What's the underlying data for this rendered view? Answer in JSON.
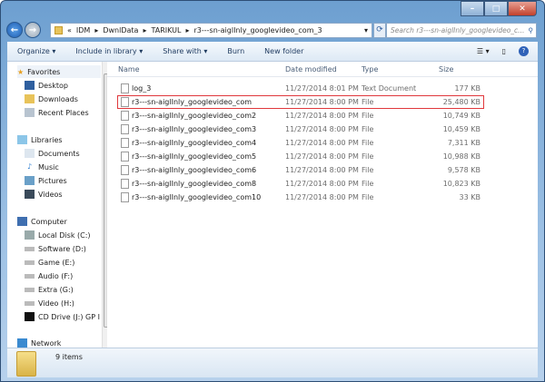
{
  "address": {
    "crumbs": [
      "IDM",
      "DwnlData",
      "TARIKUL",
      "r3---sn-aiglInly_googlevideo_com_3"
    ],
    "search_placeholder": "Search r3---sn-aiglInly_googlevideo_c..."
  },
  "toolbar": {
    "organize": "Organize ▾",
    "include": "Include in library ▾",
    "share": "Share with ▾",
    "burn": "Burn",
    "new_folder": "New folder"
  },
  "nav": {
    "favorites": {
      "label": "Favorites",
      "items": [
        "Desktop",
        "Downloads",
        "Recent Places"
      ]
    },
    "libraries": {
      "label": "Libraries",
      "items": [
        "Documents",
        "Music",
        "Pictures",
        "Videos"
      ]
    },
    "computer": {
      "label": "Computer",
      "items": [
        "Local Disk (C:)",
        "Software (D:)",
        "Game (E:)",
        "Audio (F:)",
        "Extra (G:)",
        "Video (H:)",
        "CD Drive (J:) GP I"
      ]
    },
    "network": {
      "label": "Network"
    }
  },
  "columns": {
    "name": "Name",
    "date": "Date modified",
    "type": "Type",
    "size": "Size"
  },
  "files": [
    {
      "name": "log_3",
      "date": "11/27/2014 8:01 PM",
      "type": "Text Document",
      "size": "177 KB"
    },
    {
      "name": "r3---sn-aiglInly_googlevideo_com",
      "date": "11/27/2014 8:00 PM",
      "type": "File",
      "size": "25,480 KB"
    },
    {
      "name": "r3---sn-aiglInly_googlevideo_com2",
      "date": "11/27/2014 8:00 PM",
      "type": "File",
      "size": "10,749 KB"
    },
    {
      "name": "r3---sn-aiglInly_googlevideo_com3",
      "date": "11/27/2014 8:00 PM",
      "type": "File",
      "size": "10,459 KB"
    },
    {
      "name": "r3---sn-aiglInly_googlevideo_com4",
      "date": "11/27/2014 8:00 PM",
      "type": "File",
      "size": "7,311 KB"
    },
    {
      "name": "r3---sn-aiglInly_googlevideo_com5",
      "date": "11/27/2014 8:00 PM",
      "type": "File",
      "size": "10,988 KB"
    },
    {
      "name": "r3---sn-aiglInly_googlevideo_com6",
      "date": "11/27/2014 8:00 PM",
      "type": "File",
      "size": "9,578 KB"
    },
    {
      "name": "r3---sn-aiglInly_googlevideo_com8",
      "date": "11/27/2014 8:00 PM",
      "type": "File",
      "size": "10,823 KB"
    },
    {
      "name": "r3---sn-aiglInly_googlevideo_com10",
      "date": "11/27/2014 8:00 PM",
      "type": "File",
      "size": "33 KB"
    }
  ],
  "status": {
    "count": "9 items"
  },
  "colors": {
    "highlight": "#e0383c"
  }
}
